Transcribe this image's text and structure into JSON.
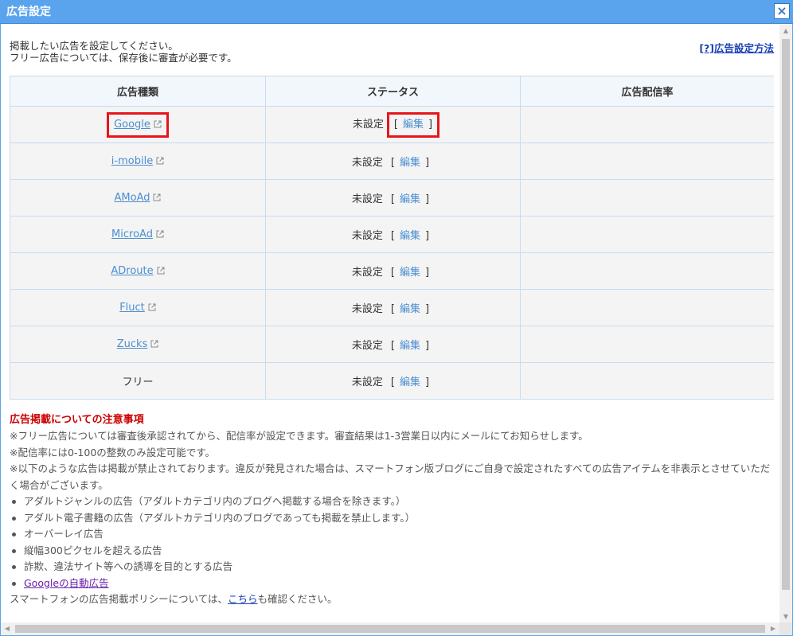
{
  "window": {
    "title": "広告設定",
    "close_label": "×"
  },
  "intro": {
    "line1": "掲載したい広告を設定してください。",
    "line2": "フリー広告については、保存後に審査が必要です。",
    "help_link": "[?]広告設定方法"
  },
  "table": {
    "headers": [
      "広告種類",
      "ステータス",
      "広告配信率"
    ],
    "rows": [
      {
        "name": "Google",
        "link": true,
        "status": "未設定",
        "edit": "編集",
        "rate": ""
      },
      {
        "name": "i-mobile",
        "link": true,
        "status": "未設定",
        "edit": "編集",
        "rate": ""
      },
      {
        "name": "AMoAd",
        "link": true,
        "status": "未設定",
        "edit": "編集",
        "rate": ""
      },
      {
        "name": "MicroAd",
        "link": true,
        "status": "未設定",
        "edit": "編集",
        "rate": ""
      },
      {
        "name": "ADroute",
        "link": true,
        "status": "未設定",
        "edit": "編集",
        "rate": ""
      },
      {
        "name": "Fluct",
        "link": true,
        "status": "未設定",
        "edit": "編集",
        "rate": ""
      },
      {
        "name": "Zucks",
        "link": true,
        "status": "未設定",
        "edit": "編集",
        "rate": ""
      },
      {
        "name": "フリー",
        "link": false,
        "status": "未設定",
        "edit": "編集",
        "rate": ""
      }
    ],
    "bracket_open": "[",
    "bracket_close": "]"
  },
  "notes": {
    "heading": "広告掲載についての注意事項",
    "p1": "※フリー広告については審査後承認されてから、配信率が設定できます。審査結果は1-3営業日以内にメールにてお知らせします。",
    "p2": "※配信率には0-100の整数のみ設定可能です。",
    "p3": "※以下のような広告は掲載が禁止されております。違反が発見された場合は、スマートフォン版ブログにご自身で設定されたすべての広告アイテムを非表示とさせていただく場合がございます。",
    "items": [
      "アダルトジャンルの広告（アダルトカテゴリ内のブログへ掲載する場合を除きます。）",
      "アダルト電子書籍の広告（アダルトカテゴリ内のブログであっても掲載を禁止します。）",
      "オーバーレイ広告",
      "縦幅300ピクセルを超える広告",
      "詐欺、違法サイト等への誘導を目的とする広告"
    ],
    "auto_ads_link": "Googleの自動広告",
    "policy_prefix": "スマートフォンの広告掲載ポリシーについては、",
    "policy_link": "こちら",
    "policy_suffix": "も確認ください。"
  },
  "highlight_color": "#e8151b",
  "accent_color": "#5aa4ee"
}
